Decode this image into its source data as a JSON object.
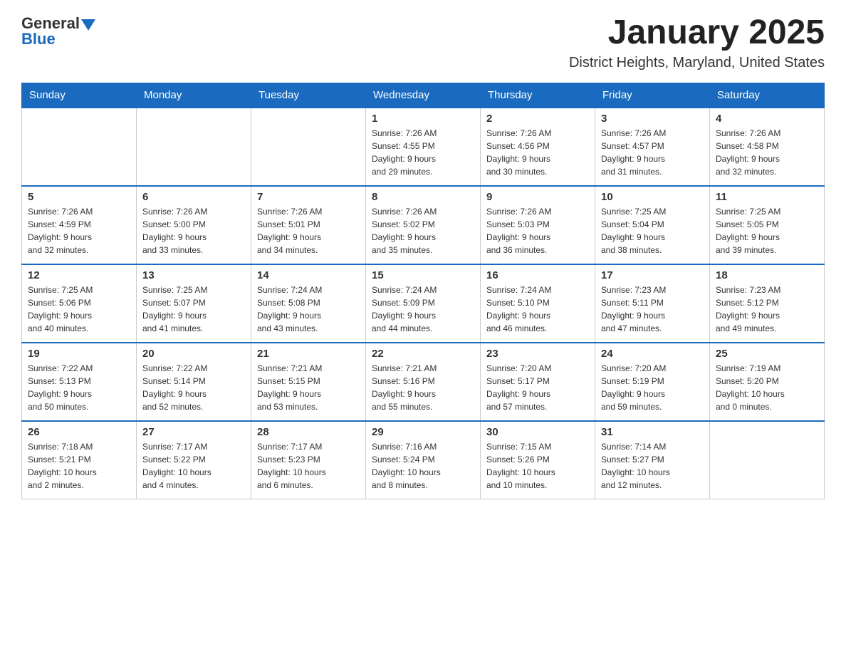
{
  "logo": {
    "text_general": "General",
    "text_blue": "Blue"
  },
  "header": {
    "month_title": "January 2025",
    "location": "District Heights, Maryland, United States"
  },
  "days_of_week": [
    "Sunday",
    "Monday",
    "Tuesday",
    "Wednesday",
    "Thursday",
    "Friday",
    "Saturday"
  ],
  "weeks": [
    [
      {
        "day": "",
        "info": ""
      },
      {
        "day": "",
        "info": ""
      },
      {
        "day": "",
        "info": ""
      },
      {
        "day": "1",
        "info": "Sunrise: 7:26 AM\nSunset: 4:55 PM\nDaylight: 9 hours\nand 29 minutes."
      },
      {
        "day": "2",
        "info": "Sunrise: 7:26 AM\nSunset: 4:56 PM\nDaylight: 9 hours\nand 30 minutes."
      },
      {
        "day": "3",
        "info": "Sunrise: 7:26 AM\nSunset: 4:57 PM\nDaylight: 9 hours\nand 31 minutes."
      },
      {
        "day": "4",
        "info": "Sunrise: 7:26 AM\nSunset: 4:58 PM\nDaylight: 9 hours\nand 32 minutes."
      }
    ],
    [
      {
        "day": "5",
        "info": "Sunrise: 7:26 AM\nSunset: 4:59 PM\nDaylight: 9 hours\nand 32 minutes."
      },
      {
        "day": "6",
        "info": "Sunrise: 7:26 AM\nSunset: 5:00 PM\nDaylight: 9 hours\nand 33 minutes."
      },
      {
        "day": "7",
        "info": "Sunrise: 7:26 AM\nSunset: 5:01 PM\nDaylight: 9 hours\nand 34 minutes."
      },
      {
        "day": "8",
        "info": "Sunrise: 7:26 AM\nSunset: 5:02 PM\nDaylight: 9 hours\nand 35 minutes."
      },
      {
        "day": "9",
        "info": "Sunrise: 7:26 AM\nSunset: 5:03 PM\nDaylight: 9 hours\nand 36 minutes."
      },
      {
        "day": "10",
        "info": "Sunrise: 7:25 AM\nSunset: 5:04 PM\nDaylight: 9 hours\nand 38 minutes."
      },
      {
        "day": "11",
        "info": "Sunrise: 7:25 AM\nSunset: 5:05 PM\nDaylight: 9 hours\nand 39 minutes."
      }
    ],
    [
      {
        "day": "12",
        "info": "Sunrise: 7:25 AM\nSunset: 5:06 PM\nDaylight: 9 hours\nand 40 minutes."
      },
      {
        "day": "13",
        "info": "Sunrise: 7:25 AM\nSunset: 5:07 PM\nDaylight: 9 hours\nand 41 minutes."
      },
      {
        "day": "14",
        "info": "Sunrise: 7:24 AM\nSunset: 5:08 PM\nDaylight: 9 hours\nand 43 minutes."
      },
      {
        "day": "15",
        "info": "Sunrise: 7:24 AM\nSunset: 5:09 PM\nDaylight: 9 hours\nand 44 minutes."
      },
      {
        "day": "16",
        "info": "Sunrise: 7:24 AM\nSunset: 5:10 PM\nDaylight: 9 hours\nand 46 minutes."
      },
      {
        "day": "17",
        "info": "Sunrise: 7:23 AM\nSunset: 5:11 PM\nDaylight: 9 hours\nand 47 minutes."
      },
      {
        "day": "18",
        "info": "Sunrise: 7:23 AM\nSunset: 5:12 PM\nDaylight: 9 hours\nand 49 minutes."
      }
    ],
    [
      {
        "day": "19",
        "info": "Sunrise: 7:22 AM\nSunset: 5:13 PM\nDaylight: 9 hours\nand 50 minutes."
      },
      {
        "day": "20",
        "info": "Sunrise: 7:22 AM\nSunset: 5:14 PM\nDaylight: 9 hours\nand 52 minutes."
      },
      {
        "day": "21",
        "info": "Sunrise: 7:21 AM\nSunset: 5:15 PM\nDaylight: 9 hours\nand 53 minutes."
      },
      {
        "day": "22",
        "info": "Sunrise: 7:21 AM\nSunset: 5:16 PM\nDaylight: 9 hours\nand 55 minutes."
      },
      {
        "day": "23",
        "info": "Sunrise: 7:20 AM\nSunset: 5:17 PM\nDaylight: 9 hours\nand 57 minutes."
      },
      {
        "day": "24",
        "info": "Sunrise: 7:20 AM\nSunset: 5:19 PM\nDaylight: 9 hours\nand 59 minutes."
      },
      {
        "day": "25",
        "info": "Sunrise: 7:19 AM\nSunset: 5:20 PM\nDaylight: 10 hours\nand 0 minutes."
      }
    ],
    [
      {
        "day": "26",
        "info": "Sunrise: 7:18 AM\nSunset: 5:21 PM\nDaylight: 10 hours\nand 2 minutes."
      },
      {
        "day": "27",
        "info": "Sunrise: 7:17 AM\nSunset: 5:22 PM\nDaylight: 10 hours\nand 4 minutes."
      },
      {
        "day": "28",
        "info": "Sunrise: 7:17 AM\nSunset: 5:23 PM\nDaylight: 10 hours\nand 6 minutes."
      },
      {
        "day": "29",
        "info": "Sunrise: 7:16 AM\nSunset: 5:24 PM\nDaylight: 10 hours\nand 8 minutes."
      },
      {
        "day": "30",
        "info": "Sunrise: 7:15 AM\nSunset: 5:26 PM\nDaylight: 10 hours\nand 10 minutes."
      },
      {
        "day": "31",
        "info": "Sunrise: 7:14 AM\nSunset: 5:27 PM\nDaylight: 10 hours\nand 12 minutes."
      },
      {
        "day": "",
        "info": ""
      }
    ]
  ]
}
